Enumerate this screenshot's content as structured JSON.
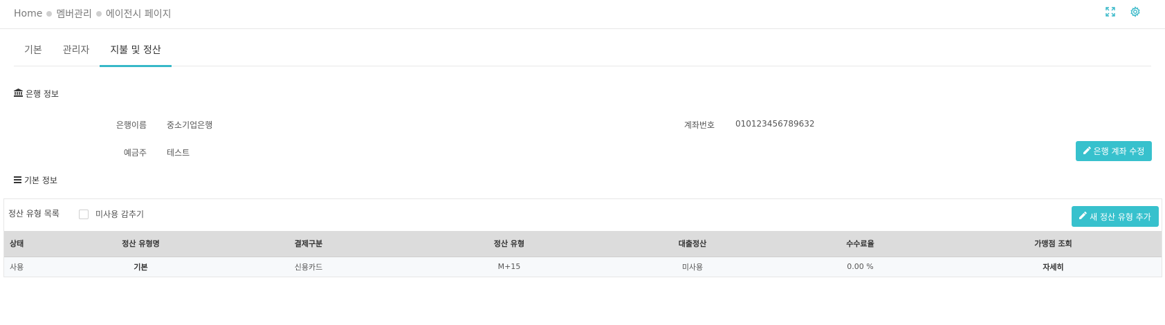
{
  "breadcrumb": {
    "home": "Home",
    "level1": "멤버관리",
    "level2": "에이전시 페이지"
  },
  "icons": {
    "expand": "expand-icon",
    "settings": "gear-icon",
    "bank": "bank-icon",
    "list": "list-icon",
    "pencil": "pencil-icon"
  },
  "tabs": [
    {
      "label": "기본"
    },
    {
      "label": "관리자"
    },
    {
      "label": "지불 및 정산"
    }
  ],
  "bank_section": {
    "title": "은행 정보",
    "bank_name_label": "은행이름",
    "bank_name_value": "중소기업은행",
    "account_label": "계좌번호",
    "account_value": "010123456789632",
    "holder_label": "예금주",
    "holder_value": "테스트",
    "edit_button": "은행 계좌 수정"
  },
  "basic_section": {
    "title": "기본 정보"
  },
  "settlement": {
    "title": "정산 유형 목록",
    "hide_unused_label": "미사용 감추기",
    "add_button": "새 정산 유형 추가",
    "columns": [
      "상태",
      "정산 유형명",
      "결제구분",
      "정산 유형",
      "대출정산",
      "수수료율",
      "가맹점 조회"
    ],
    "rows": [
      [
        "사용",
        "기본",
        "신용카드",
        "M+15",
        "미사용",
        "0.00 %",
        "자세히"
      ]
    ]
  },
  "colors": {
    "accent": "#37b8c8",
    "button": "#37c1cd",
    "header_bg": "#dcdcdc"
  }
}
